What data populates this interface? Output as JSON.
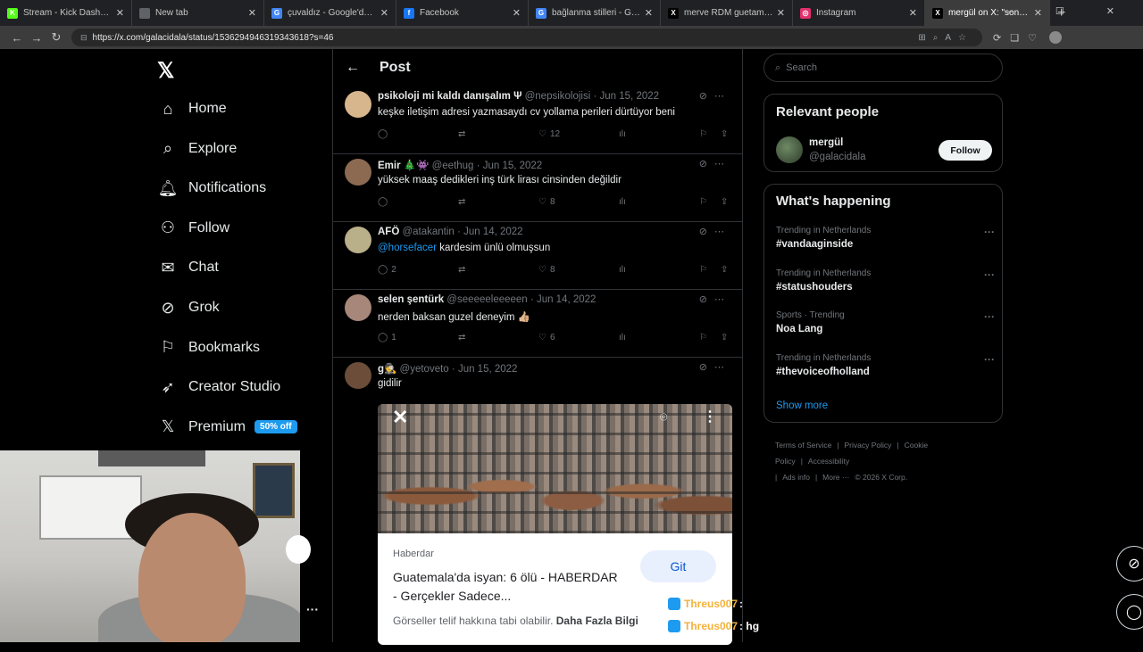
{
  "browser": {
    "tabs": [
      {
        "title": "Stream - Kick Dashboard",
        "favicon": "K",
        "color": "#53fc18"
      },
      {
        "title": "New tab",
        "favicon": "",
        "color": "#5f6368"
      },
      {
        "title": "çuvaldız - Google'da Ara",
        "favicon": "G",
        "color": "#4285f4"
      },
      {
        "title": "Facebook",
        "favicon": "f",
        "color": "#1877f2"
      },
      {
        "title": "bağlanma stilleri - Google'da",
        "favicon": "G",
        "color": "#4285f4"
      },
      {
        "title": "merve RDM guetamala - Sea",
        "favicon": "X",
        "color": "#000000"
      },
      {
        "title": "Instagram",
        "favicon": "◎",
        "color": "#e1306c"
      },
      {
        "title": "mergül on X: \"sonunda hay",
        "favicon": "X",
        "color": "#000000"
      }
    ],
    "url": "https://x.com/galacidala/status/1536294946319343618?s=46"
  },
  "nav": {
    "items": [
      {
        "label": "Home",
        "icon": "home-icon"
      },
      {
        "label": "Explore",
        "icon": "search-icon"
      },
      {
        "label": "Notifications",
        "icon": "bell-icon"
      },
      {
        "label": "Follow",
        "icon": "add-person-icon"
      },
      {
        "label": "Chat",
        "icon": "envelope-icon"
      },
      {
        "label": "Grok",
        "icon": "grok-icon"
      },
      {
        "label": "Bookmarks",
        "icon": "bookmark-icon"
      },
      {
        "label": "Creator Studio",
        "icon": "rocket-icon"
      },
      {
        "label": "Premium",
        "icon": "x-icon"
      }
    ],
    "premium_badge": "50% off"
  },
  "post": {
    "title": "Post"
  },
  "replies": [
    {
      "name": "psikoloji mi kaldı danışalım Ψ",
      "handle": "@nepsikolojisi",
      "date": "Jun 15, 2022",
      "text": "keşke iletişim adresi yazmasaydı cv yollama perileri dürtüyor beni",
      "replies": "",
      "reposts": "",
      "likes": "12",
      "avatar_color": "#d7b58d"
    },
    {
      "name": "Emir 🎄👾",
      "handle": "@eethug",
      "date": "Jun 15, 2022",
      "text": "yüksek maaş dedikleri inş türk lirası cinsinden değildir",
      "replies": "",
      "reposts": "",
      "likes": "8",
      "avatar_color": "#8c6a52"
    },
    {
      "name": "AFÖ",
      "handle": "@atakantin",
      "date": "Jun 14, 2022",
      "mention": "@horsefacer",
      "text": " kardesim ünlü olmuşsun",
      "replies": "2",
      "reposts": "",
      "likes": "8",
      "avatar_color": "#b9b08a"
    },
    {
      "name": "selen şentürk",
      "handle": "@seeeeeleeeeen",
      "date": "Jun 14, 2022",
      "text": "nerden baksan guzel deneyim 👍🏼",
      "replies": "1",
      "reposts": "",
      "likes": "6",
      "avatar_color": "#a6877a"
    }
  ],
  "last_reply": {
    "name": "g🕵",
    "handle": "@yetoveto",
    "date": "Jun 15, 2022",
    "text": "gidilir",
    "avatar_color": "#6b4d3a",
    "card": {
      "source": "Haberdar",
      "title": "Guatemala'da isyan: 6 ölü - HABERDAR - Gerçekler Sadece...",
      "button": "Git",
      "disclaimer": "Görseller telif hakkına tabi olabilir. ",
      "disclaimer_link": "Daha Fazla Bilgi"
    }
  },
  "right": {
    "search_placeholder": "Search",
    "relevant_title": "Relevant people",
    "relevant_name": "mergül",
    "relevant_handle": "@galacidala",
    "follow_label": "Follow",
    "happening_title": "What's happening",
    "trends": [
      {
        "meta": "Trending in Netherlands",
        "name": "#vandaaginside"
      },
      {
        "meta": "Trending in Netherlands",
        "name": "#statushouders"
      },
      {
        "meta": "Sports · Trending",
        "name": "Noa Lang"
      },
      {
        "meta": "Trending in Netherlands",
        "name": "#thevoiceofholland"
      }
    ],
    "show_more": "Show more",
    "footer": [
      "Terms of Service",
      "|",
      "Privacy Policy",
      "|",
      "Cookie Policy",
      "|",
      "Accessibility",
      "|",
      "Ads info",
      "|",
      "More ···",
      "© 2026 X Corp."
    ]
  },
  "overlay_chat": [
    {
      "user": "Threus007",
      "msg": ":"
    },
    {
      "user": "Threus007",
      "msg": ": hg"
    }
  ]
}
